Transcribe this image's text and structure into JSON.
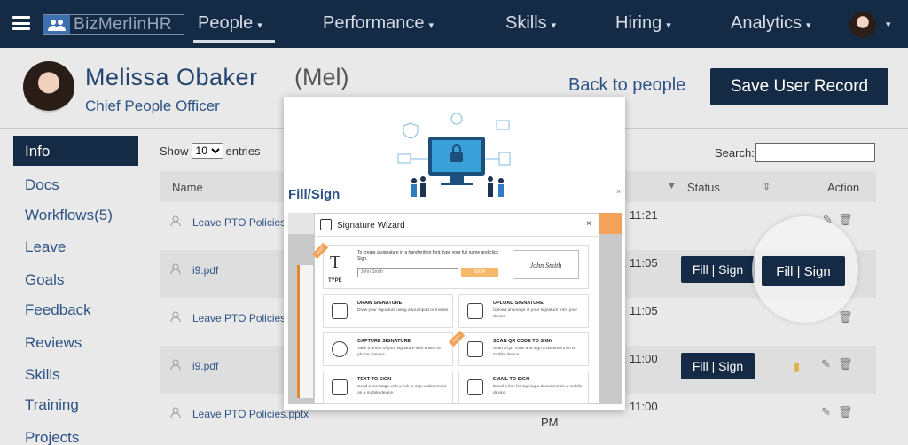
{
  "nav": {
    "logo_text": "BizMerlinHR",
    "items": [
      {
        "label": "People",
        "caret": "▾"
      },
      {
        "label": "Performance",
        "caret": "▾"
      },
      {
        "label": "Skills",
        "caret": "▾"
      },
      {
        "label": "Hiring",
        "caret": "▾"
      },
      {
        "label": "Analytics",
        "caret": "▾"
      }
    ],
    "avatar_caret": "▾",
    "bg_color": "#152a45"
  },
  "header": {
    "name": "Melissa Obaker",
    "nickname": "(Mel)",
    "title": "Chief People Officer",
    "back_link": "Back to people",
    "save_button": "Save User Record"
  },
  "sidebar": {
    "active": "Info",
    "items": [
      "Docs",
      "Workflows(5)",
      "Leave",
      "Goals",
      "Feedback",
      "Reviews",
      "Skills",
      "Training",
      "Projects"
    ]
  },
  "table": {
    "show_label": "Show",
    "entries_value": "10",
    "entries_label": "entries",
    "search_label": "Search:",
    "columns": {
      "name": "Name",
      "status": "Status",
      "action": "Action"
    },
    "rows": [
      {
        "file": "Leave PTO Policies.",
        "time": "11:21",
        "pm": "",
        "fill": ""
      },
      {
        "file": "i9.pdf",
        "time": "11:05",
        "pm": "",
        "fill": "Fill | Sign"
      },
      {
        "file": "Leave PTO Policies.",
        "time": "11:05",
        "pm": "",
        "fill": ""
      },
      {
        "file": "i9.pdf",
        "time": "11:00",
        "pm": "",
        "fill": "Fill | Sign"
      },
      {
        "file": "Leave PTO Policies.pptx",
        "time": "11:00",
        "pm": "PM",
        "fill": ""
      }
    ]
  },
  "magnifier": {
    "button": "Fill | Sign"
  },
  "overlay": {
    "title": "Fill/Sign",
    "wizard_title": "Signature Wizard",
    "type_text": "To create a signature in a handwritten font, type your full name and click Sign.",
    "type_label": "TYPE",
    "type_input": "John Smith",
    "sign_button": "SIGN",
    "signature_preview": "John Smith",
    "ribbon": "FAST",
    "options": [
      {
        "title": "DRAW SIGNATURE",
        "desc": "Draw your signature using a touchpad or mouse.",
        "icon": "pen-icon"
      },
      {
        "title": "UPLOAD SIGNATURE",
        "desc": "Upload an image of your signature from your device.",
        "icon": "upload-icon"
      },
      {
        "title": "CAPTURE SIGNATURE",
        "desc": "Take a photo of your signature with a web or phone camera.",
        "icon": "camera-icon"
      },
      {
        "title": "SCAN QR CODE TO SIGN",
        "desc": "Scan a QR code and sign a document on a mobile device.",
        "icon": "qr-icon"
      },
      {
        "title": "TEXT TO SIGN",
        "desc": "Send a message with a link to sign a document on a mobile device.",
        "icon": "sms-icon"
      },
      {
        "title": "EMAIL TO SIGN",
        "desc": "Email a link for signing a document on a mobile device.",
        "icon": "email-icon"
      }
    ]
  }
}
